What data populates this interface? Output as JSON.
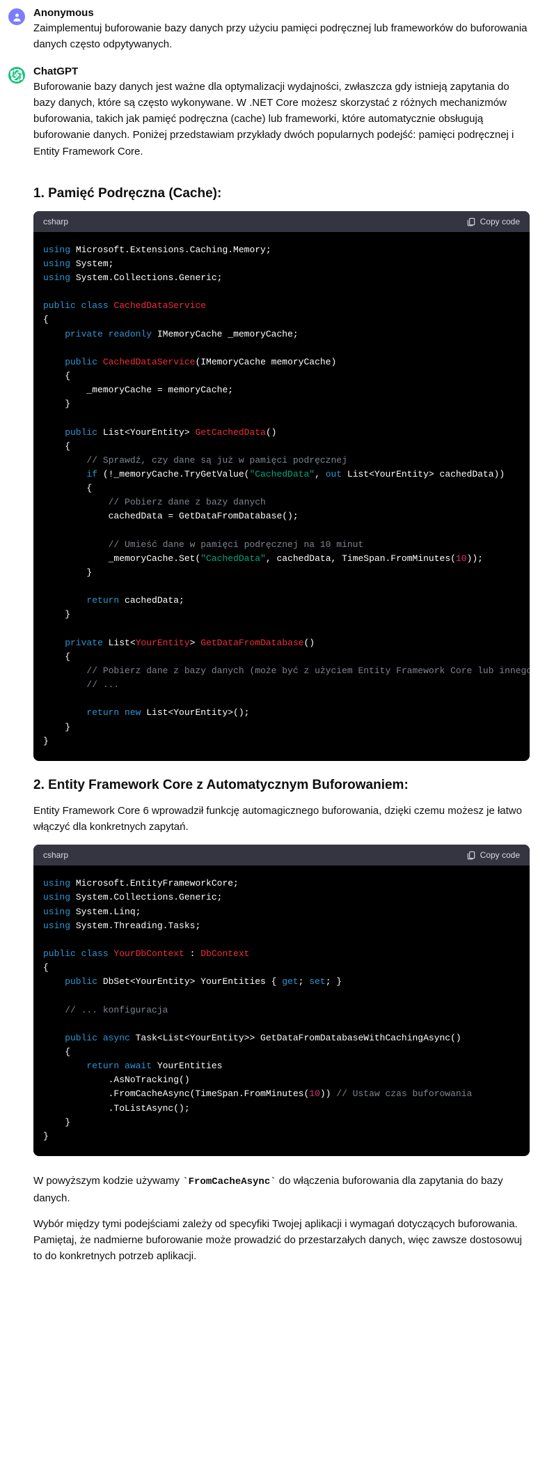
{
  "user": {
    "author": "Anonymous",
    "text": "Zaimplementuj buforowanie bazy danych przy użyciu pamięci podręcznej lub frameworków do buforowania danych często odpytywanych."
  },
  "bot": {
    "author": "ChatGPT",
    "intro": "Buforowanie bazy danych jest ważne dla optymalizacji wydajności, zwłaszcza gdy istnieją zapytania do bazy danych, które są często wykonywane. W .NET Core możesz skorzystać z różnych mechanizmów buforowania, takich jak pamięć podręczna (cache) lub frameworki, które automatycznie obsługują buforowanie danych. Poniżej przedstawiam przykłady dwóch popularnych podejść: pamięci podręcznej i Entity Framework Core.",
    "section1_title": "1. Pamięć Podręczna (Cache):",
    "code1_lang": "csharp",
    "copy_label": "Copy code",
    "section2_title": "2. Entity Framework Core z Automatycznym Buforowaniem:",
    "section2_intro": "Entity Framework Core 6 wprowadził funkcję automagicznego buforowania, dzięki czemu możesz je łatwo włączyć dla konkretnych zapytań.",
    "code2_lang": "csharp",
    "outro1_a": "W powyższym kodzie używamy ",
    "outro1_code": "`FromCacheAsync`",
    "outro1_b": " do włączenia buforowania dla zapytania do bazy danych.",
    "outro2": "Wybór między tymi podejściami zależy od specyfiki Twojej aplikacji i wymagań dotyczących buforowania. Pamiętaj, że nadmierne buforowanie może prowadzić do przestarzałych danych, więc zawsze dostosowuj to do konkretnych potrzeb aplikacji."
  },
  "code1": {
    "l1_using": "using",
    "l1_ns": " Microsoft.Extensions.Caching.Memory;",
    "l2_using": "using",
    "l2_ns": " System;",
    "l3_using": "using",
    "l3_ns": " System.Collections.Generic;",
    "l5_pub": "public",
    "l5_cls": " class",
    "l5_name": " CachedDataService",
    "l6": "{",
    "l7_vis": "    private",
    "l7_ro": " readonly",
    "l7_rest": " IMemoryCache _memoryCache;",
    "l9_pub": "    public",
    "l9_name": " CachedDataService",
    "l9_sig": "(IMemoryCache memoryCache)",
    "l10": "    {",
    "l11": "        _memoryCache = memoryCache;",
    "l12": "    }",
    "l14_pub": "    public",
    "l14_rest1": " List<YourEntity> ",
    "l14_fn": "GetCachedData",
    "l14_rest2": "()",
    "l15": "    {",
    "l16_cm": "        // Sprawdź, czy dane są już w pamięci podręcznej",
    "l17_if": "        if",
    "l17_a": " (!_memoryCache.TryGetValue(",
    "l17_str": "\"CachedData\"",
    "l17_b": ", ",
    "l17_out": "out",
    "l17_c": " List<YourEntity> cachedData))",
    "l18": "        {",
    "l19_cm": "            // Pobierz dane z bazy danych",
    "l20": "            cachedData = GetDataFromDatabase();",
    "l22_cm": "            // Umieść dane w pamięci podręcznej na 10 minut",
    "l23_a": "            _memoryCache.Set(",
    "l23_str": "\"CachedData\"",
    "l23_b": ", cachedData, TimeSpan.FromMinutes(",
    "l23_num": "10",
    "l23_c": "));",
    "l24": "        }",
    "l26_ret": "        return",
    "l26_rest": " cachedData;",
    "l27": "    }",
    "l29_vis": "    private",
    "l29_a": " List<",
    "l29_type": "YourEntity",
    "l29_b": "> ",
    "l29_fn": "GetDataFromDatabase",
    "l29_c": "()",
    "l30": "    {",
    "l31_cm": "        // Pobierz dane z bazy danych (może być z użyciem Entity Framework Core lub innego narzędzia)",
    "l32_cm": "        // ...",
    "l34_ret": "        return",
    "l34_new": " new",
    "l34_rest": " List<YourEntity>();",
    "l35": "    }",
    "l36": "}"
  },
  "code2": {
    "l1_using": "using",
    "l1_ns": " Microsoft.EntityFrameworkCore;",
    "l2_using": "using",
    "l2_ns": " System.Collections.Generic;",
    "l3_using": "using",
    "l3_ns": " System.Linq;",
    "l4_using": "using",
    "l4_ns": " System.Threading.Tasks;",
    "l6_pub": "public",
    "l6_cls": " class",
    "l6_name": " YourDbContext",
    "l6_colon": " : ",
    "l6_base": "DbContext",
    "l7": "{",
    "l8_pub": "    public",
    "l8_a": " DbSet<YourEntity> YourEntities { ",
    "l8_get": "get",
    "l8_b": "; ",
    "l8_set": "set",
    "l8_c": "; }",
    "l10_cm": "    // ... konfiguracja",
    "l12_pub": "    public",
    "l12_async": " async",
    "l12_rest": " Task<List<YourEntity>> GetDataFromDatabaseWithCachingAsync()",
    "l13": "    {",
    "l14_ret": "        return",
    "l14_await": " await",
    "l14_rest": " YourEntities",
    "l15": "            .AsNoTracking()",
    "l16_a": "            .FromCacheAsync(TimeSpan.FromMinutes(",
    "l16_num": "10",
    "l16_b": ")) ",
    "l16_cm": "// Ustaw czas buforowania",
    "l17": "            .ToListAsync();",
    "l18": "    }",
    "l19": "}"
  }
}
